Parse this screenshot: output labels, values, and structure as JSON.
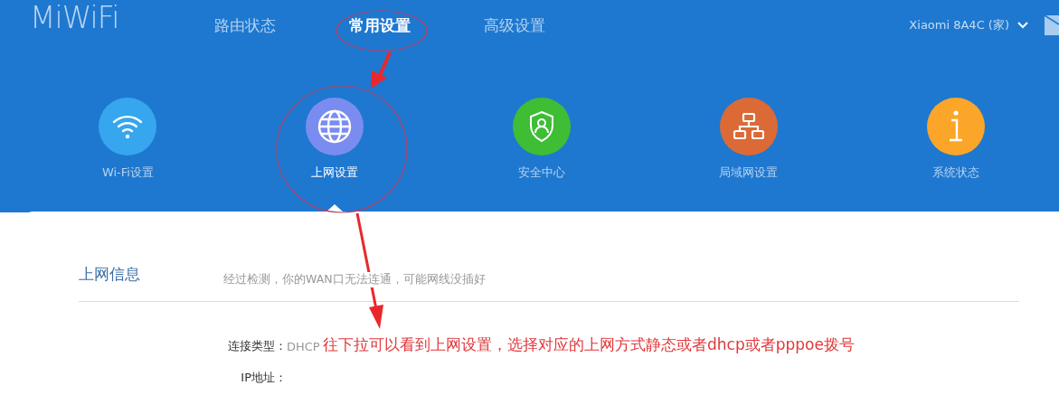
{
  "header": {
    "logo": "MiWiFi",
    "nav": [
      {
        "label": "路由状态",
        "selected": false
      },
      {
        "label": "常用设置",
        "selected": true
      },
      {
        "label": "高级设置",
        "selected": false
      }
    ],
    "device": "Xiaomi  8A4C (家)"
  },
  "settings": [
    {
      "kind": "wifi",
      "label": "Wi-Fi设置",
      "color": "#36a6ee",
      "selected": false
    },
    {
      "kind": "globe",
      "label": "上网设置",
      "color": "#7b8cf0",
      "selected": true
    },
    {
      "kind": "shield",
      "label": "安全中心",
      "color": "#3fbd35",
      "selected": false
    },
    {
      "kind": "network",
      "label": "局域网设置",
      "color": "#db6a37",
      "selected": false
    },
    {
      "kind": "info",
      "label": "系统状态",
      "color": "#fba529",
      "selected": false
    }
  ],
  "panel": {
    "title": "上网信息",
    "notice": "经过检测，你的WAN口无法连通，可能网线没插好",
    "fields": [
      {
        "label": "连接类型：",
        "value": "DHCP"
      },
      {
        "label": "IP地址："
      }
    ]
  },
  "annotation": {
    "text": "往下拉可以看到上网设置，选择对应的上网方式静态或者dhcp或者pppoe拨号"
  }
}
